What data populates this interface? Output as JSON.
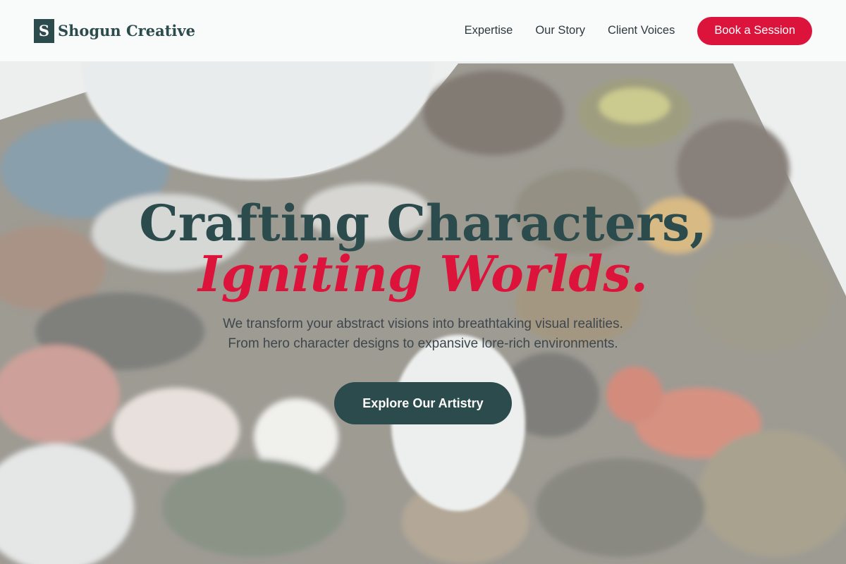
{
  "brand": {
    "mark": "S",
    "name": "Shogun Creative"
  },
  "nav": {
    "links": [
      "Expertise",
      "Our Story",
      "Client Voices"
    ],
    "cta_label": "Book a Session"
  },
  "hero": {
    "headline_line1": "Crafting Characters,",
    "headline_line2": "Igniting Worlds.",
    "subhead_line1": "We transform your abstract visions into breathtaking visual realities.",
    "subhead_line2": "From hero character designs to expansive lore-rich environments.",
    "button_label": "Explore Our Artistry",
    "background_image": "painted-palette-photo"
  },
  "colors": {
    "primary": "#2b4b4c",
    "accent": "#dc143c",
    "text": "#2f3a3f"
  }
}
